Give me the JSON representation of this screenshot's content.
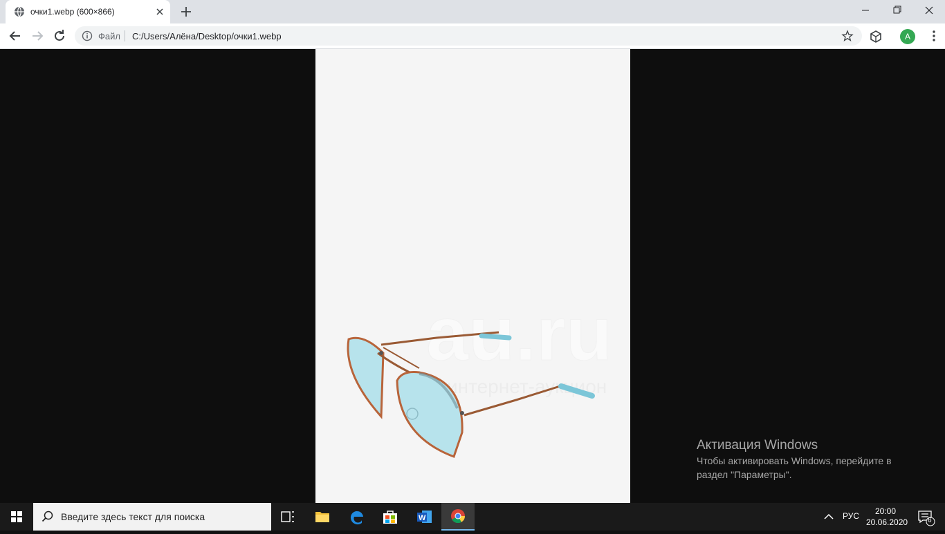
{
  "browser": {
    "tab": {
      "title": "очки1.webp (600×866)",
      "favicon": "globe-icon"
    },
    "address": {
      "scheme_label": "Файл",
      "url": "C:/Users/Алёна/Desktop/очки1.webp"
    },
    "profile_initial": "A"
  },
  "image": {
    "subject": "sunglasses",
    "watermark_logo": "au.ru",
    "watermark_tagline": "интернет-аукцион",
    "lens_color": "#b7e3ec",
    "frame_color": "#b8643a"
  },
  "activation": {
    "title": "Активация Windows",
    "text": "Чтобы активировать Windows, перейдите в раздел \"Параметры\"."
  },
  "taskbar": {
    "search_placeholder": "Введите здесь текст для поиска",
    "pinned": [
      "task-view-icon",
      "file-explorer-icon",
      "edge-icon",
      "store-icon",
      "word-icon",
      "chrome-icon"
    ],
    "lang": "РУС",
    "time": "20:00",
    "date": "20.06.2020",
    "notification_count": "6"
  },
  "colors": {
    "chrome_tabstrip": "#dee1e6",
    "viewer_bg": "#0e0e0e",
    "taskbar": "#1a1a1a",
    "profile": "#34a853"
  }
}
